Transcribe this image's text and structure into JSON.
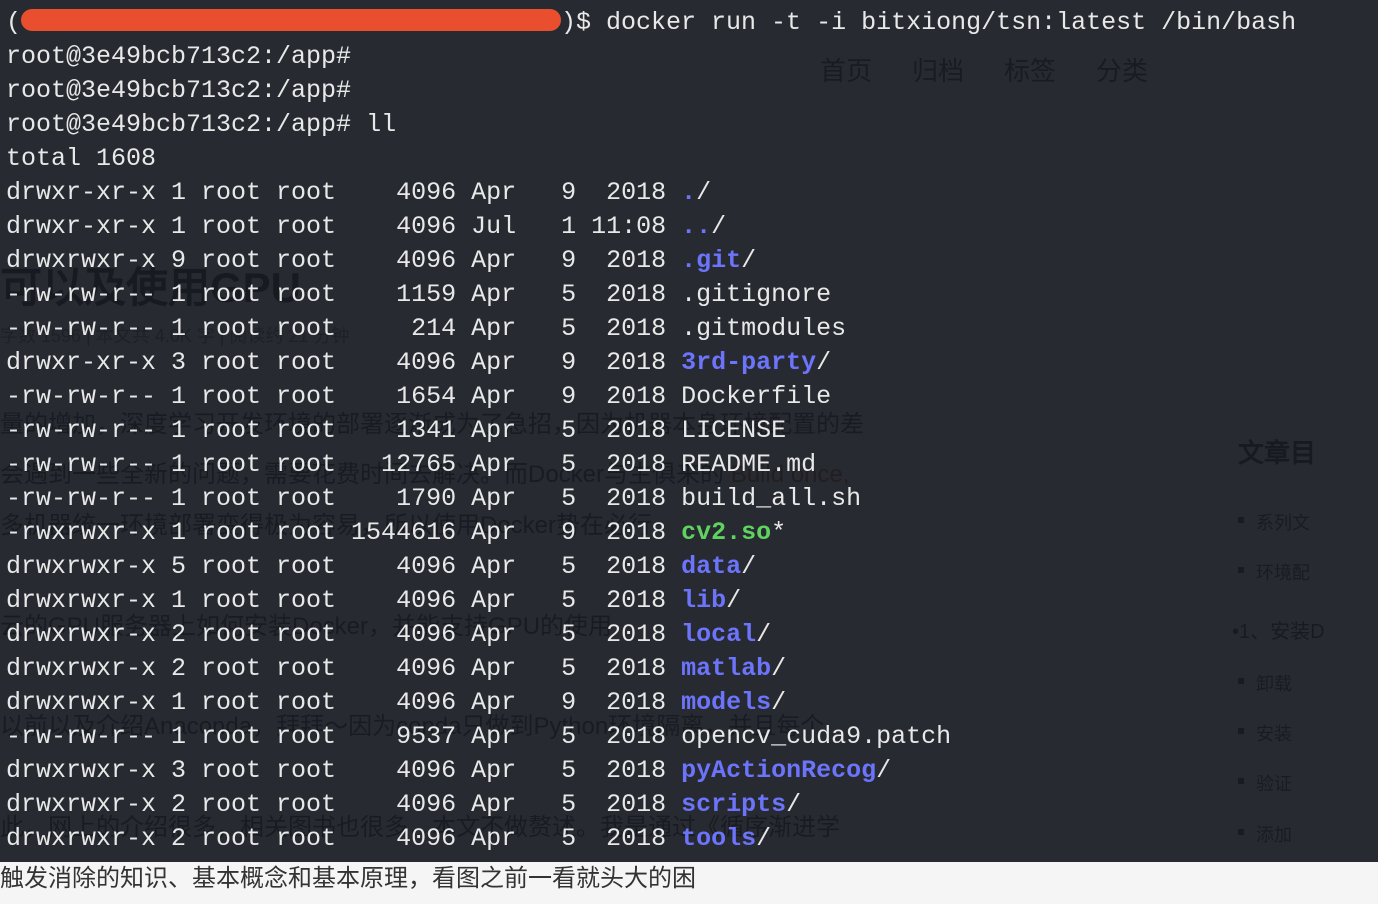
{
  "bg": {
    "nav": [
      "首页",
      "归档",
      "标签",
      "分类"
    ],
    "title": "可以及使用GPU",
    "meta": "字数 1596 | 本文共 4.0K 字 | 阅读约 21 分钟",
    "body_lines": [
      {
        "plain": "量的增加，深度学习开发环境的部署逐渐成为了急招，因为机器本身环境配置的差"
      },
      {
        "plain": "会遇到一些全新的问题，需要花费时间去解决。而Docker与生俱来的 ",
        "code": "Build once,"
      },
      {
        "plain": "多机器统一环境部署变得极为容易，所以使用Docker势在必行"
      },
      {
        "plain": ""
      },
      {
        "plain": "云的GPU服务器上如何安装Docker，并能支持GPU的使用"
      },
      {
        "plain": ""
      },
      {
        "plain": "以前以及介绍Anaconda，拜拜～因为conda只做到Python环境隔离，并且每个"
      },
      {
        "plain": ""
      },
      {
        "plain": "此，网上的介绍很多，相关图书也很多，本文不做赘述。我是通过《循序渐进学"
      },
      {
        "plain": "触发消除的知识、基本概念和基本原理，看图之前一看就头大的困"
      }
    ],
    "sidebar": {
      "title": "文章目",
      "items": [
        "系列文",
        "环境配"
      ],
      "num_item": "1、安装D",
      "sub_items": [
        "卸载",
        "安装",
        "验证",
        "添加"
      ]
    }
  },
  "term": {
    "first_line_prefix": "(",
    "first_line_suffix": ")$ ",
    "first_cmd": "docker run -t -i bitxiong/tsn:latest /bin/bash",
    "prompt": "root@3e49bcb713c2:/app# ",
    "cmd_ll": "ll",
    "total": "total 1608",
    "rows": [
      {
        "perm": "drwxr-xr-x",
        "n": "1",
        "own": "root",
        "grp": "root",
        "size": "   4096",
        "mon": "Apr",
        "day": "  9",
        "time": " 2018",
        "name": ".",
        "suffix": "/",
        "cls": "fg-dir"
      },
      {
        "perm": "drwxr-xr-x",
        "n": "1",
        "own": "root",
        "grp": "root",
        "size": "   4096",
        "mon": "Jul",
        "day": "  1",
        "time": "11:08",
        "name": "..",
        "suffix": "/",
        "cls": "fg-dir"
      },
      {
        "perm": "drwxrwxr-x",
        "n": "9",
        "own": "root",
        "grp": "root",
        "size": "   4096",
        "mon": "Apr",
        "day": "  9",
        "time": " 2018",
        "name": ".git",
        "suffix": "/",
        "cls": "fg-dir"
      },
      {
        "perm": "-rw-rw-r--",
        "n": "1",
        "own": "root",
        "grp": "root",
        "size": "   1159",
        "mon": "Apr",
        "day": "  5",
        "time": " 2018",
        "name": ".gitignore",
        "suffix": "",
        "cls": ""
      },
      {
        "perm": "-rw-rw-r--",
        "n": "1",
        "own": "root",
        "grp": "root",
        "size": "    214",
        "mon": "Apr",
        "day": "  5",
        "time": " 2018",
        "name": ".gitmodules",
        "suffix": "",
        "cls": ""
      },
      {
        "perm": "drwxr-xr-x",
        "n": "3",
        "own": "root",
        "grp": "root",
        "size": "   4096",
        "mon": "Apr",
        "day": "  9",
        "time": " 2018",
        "name": "3rd-party",
        "suffix": "/",
        "cls": "fg-dir"
      },
      {
        "perm": "-rw-rw-r--",
        "n": "1",
        "own": "root",
        "grp": "root",
        "size": "   1654",
        "mon": "Apr",
        "day": "  9",
        "time": " 2018",
        "name": "Dockerfile",
        "suffix": "",
        "cls": ""
      },
      {
        "perm": "-rw-rw-r--",
        "n": "1",
        "own": "root",
        "grp": "root",
        "size": "   1341",
        "mon": "Apr",
        "day": "  5",
        "time": " 2018",
        "name": "LICENSE",
        "suffix": "",
        "cls": ""
      },
      {
        "perm": "-rw-rw-r--",
        "n": "1",
        "own": "root",
        "grp": "root",
        "size": "  12765",
        "mon": "Apr",
        "day": "  5",
        "time": " 2018",
        "name": "README.md",
        "suffix": "",
        "cls": ""
      },
      {
        "perm": "-rw-rw-r--",
        "n": "1",
        "own": "root",
        "grp": "root",
        "size": "   1790",
        "mon": "Apr",
        "day": "  5",
        "time": " 2018",
        "name": "build_all.sh",
        "suffix": "",
        "cls": ""
      },
      {
        "perm": "-rwxrwxr-x",
        "n": "1",
        "own": "root",
        "grp": "root",
        "size": "1544616",
        "mon": "Apr",
        "day": "  9",
        "time": " 2018",
        "name": "cv2.so",
        "suffix": "*",
        "cls": "fg-exec"
      },
      {
        "perm": "drwxrwxr-x",
        "n": "5",
        "own": "root",
        "grp": "root",
        "size": "   4096",
        "mon": "Apr",
        "day": "  5",
        "time": " 2018",
        "name": "data",
        "suffix": "/",
        "cls": "fg-dir"
      },
      {
        "perm": "drwxrwxr-x",
        "n": "1",
        "own": "root",
        "grp": "root",
        "size": "   4096",
        "mon": "Apr",
        "day": "  5",
        "time": " 2018",
        "name": "lib",
        "suffix": "/",
        "cls": "fg-dir"
      },
      {
        "perm": "drwxrwxr-x",
        "n": "2",
        "own": "root",
        "grp": "root",
        "size": "   4096",
        "mon": "Apr",
        "day": "  5",
        "time": " 2018",
        "name": "local",
        "suffix": "/",
        "cls": "fg-dir"
      },
      {
        "perm": "drwxrwxr-x",
        "n": "2",
        "own": "root",
        "grp": "root",
        "size": "   4096",
        "mon": "Apr",
        "day": "  5",
        "time": " 2018",
        "name": "matlab",
        "suffix": "/",
        "cls": "fg-dir"
      },
      {
        "perm": "drwxrwxr-x",
        "n": "1",
        "own": "root",
        "grp": "root",
        "size": "   4096",
        "mon": "Apr",
        "day": "  9",
        "time": " 2018",
        "name": "models",
        "suffix": "/",
        "cls": "fg-dir"
      },
      {
        "perm": "-rw-rw-r--",
        "n": "1",
        "own": "root",
        "grp": "root",
        "size": "   9537",
        "mon": "Apr",
        "day": "  5",
        "time": " 2018",
        "name": "opencv_cuda9.patch",
        "suffix": "",
        "cls": ""
      },
      {
        "perm": "drwxrwxr-x",
        "n": "3",
        "own": "root",
        "grp": "root",
        "size": "   4096",
        "mon": "Apr",
        "day": "  5",
        "time": " 2018",
        "name": "pyActionRecog",
        "suffix": "/",
        "cls": "fg-dir"
      },
      {
        "perm": "drwxrwxr-x",
        "n": "2",
        "own": "root",
        "grp": "root",
        "size": "   4096",
        "mon": "Apr",
        "day": "  5",
        "time": " 2018",
        "name": "scripts",
        "suffix": "/",
        "cls": "fg-dir"
      },
      {
        "perm": "drwxrwxr-x",
        "n": "2",
        "own": "root",
        "grp": "root",
        "size": "   4096",
        "mon": "Apr",
        "day": "  5",
        "time": " 2018",
        "name": "tools",
        "suffix": "/",
        "cls": "fg-dir"
      }
    ]
  }
}
